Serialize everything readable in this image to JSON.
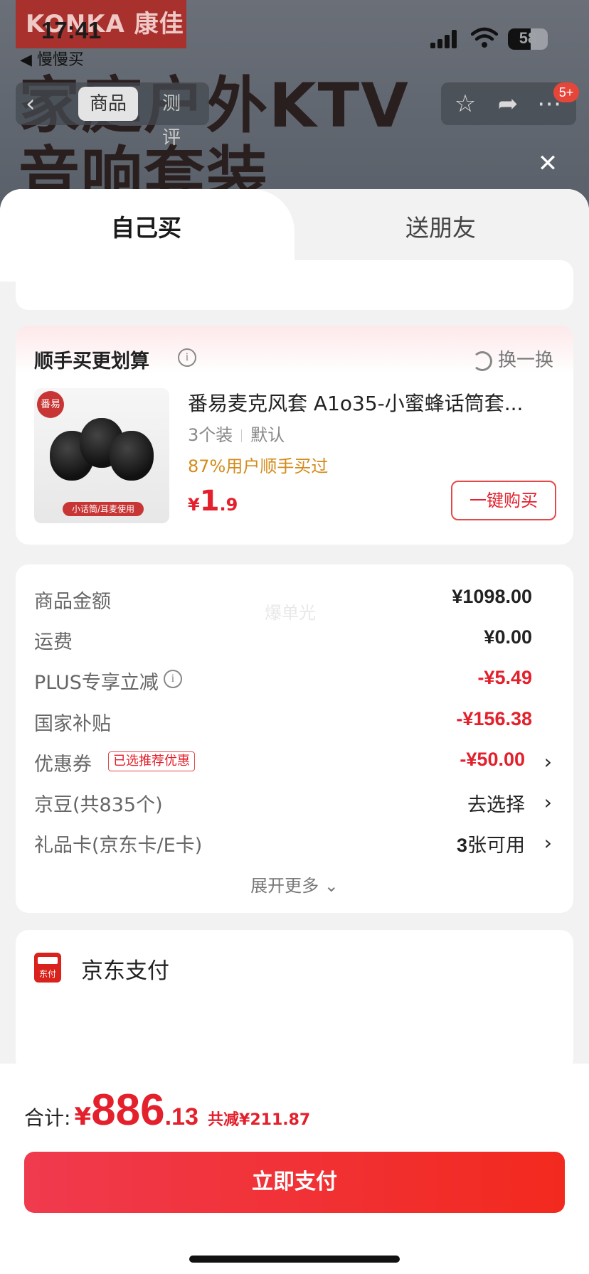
{
  "status_bar": {
    "time": "17:41",
    "back_app": "◀ 慢慢买",
    "battery": "58"
  },
  "background": {
    "brand": "KONKA 康佳",
    "headline_line1": "家庭户外KTV",
    "headline_line2": "音响套装"
  },
  "nav": {
    "tab_product": "商品",
    "tab_review": "测评",
    "badge": "5+"
  },
  "sheet": {
    "tabs": {
      "self": "自己买",
      "friend": "送朋友"
    },
    "upsell": {
      "title": "顺手买更划算",
      "swap": "换一换",
      "product": {
        "logo": "番易",
        "tag": "小话筒/耳麦使用",
        "name": "番易麦克风套 A1o35-小蜜蜂话筒套...",
        "spec_count": "3个装",
        "spec_style": "默认",
        "social": "87%用户顺手买过",
        "price_currency": "¥",
        "price_int": "1",
        "price_dec": ".9",
        "buy_label": "一键购买"
      }
    },
    "summary": {
      "watermark": "爆单光",
      "rows": [
        {
          "label": "商品金额",
          "value": "¥1098.00"
        },
        {
          "label": "运费",
          "value": "¥0.00"
        },
        {
          "label": "PLUS专享立减",
          "value": "-¥5.49"
        },
        {
          "label": "国家补贴",
          "value": "-¥156.38"
        },
        {
          "label": "优惠券",
          "tag": "已选推荐优惠",
          "value": "-¥50.00"
        },
        {
          "label": "京豆(共835个)",
          "value": "去选择"
        },
        {
          "label": "礼品卡(京东卡/E卡)",
          "value_num": "3",
          "value": "张可用"
        }
      ],
      "expand": "展开更多"
    },
    "payment": {
      "icon_text": "东付",
      "title": "京东支付"
    }
  },
  "bottom": {
    "total_label": "合计:",
    "currency": "¥",
    "total_int": "886",
    "total_dec": ".13",
    "saved": "共减¥211.87",
    "pay_button": "立即支付"
  },
  "colors": {
    "accent_red": "#e3202c",
    "button_gradient_start": "#f03a4e",
    "button_gradient_end": "#f2291e"
  }
}
